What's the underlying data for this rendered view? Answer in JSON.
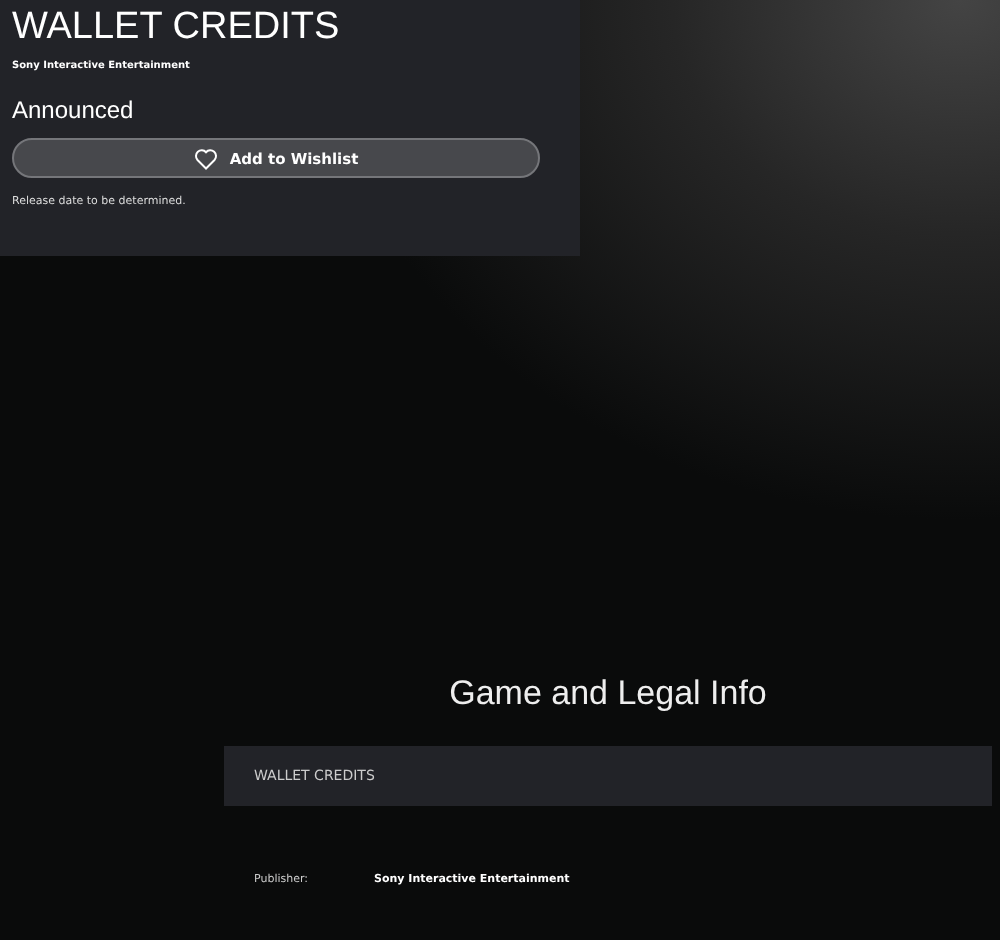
{
  "product": {
    "title": "WALLET CREDITS",
    "publisher": "Sony Interactive Entertainment",
    "status": "Announced",
    "wishlist_button": "Add to Wishlist",
    "release_note": "Release date to be determined."
  },
  "legal": {
    "heading": "Game and Legal Info",
    "product_name": "WALLET CREDITS",
    "details": [
      {
        "label": "Publisher:",
        "value": "Sony Interactive Entertainment"
      }
    ]
  }
}
